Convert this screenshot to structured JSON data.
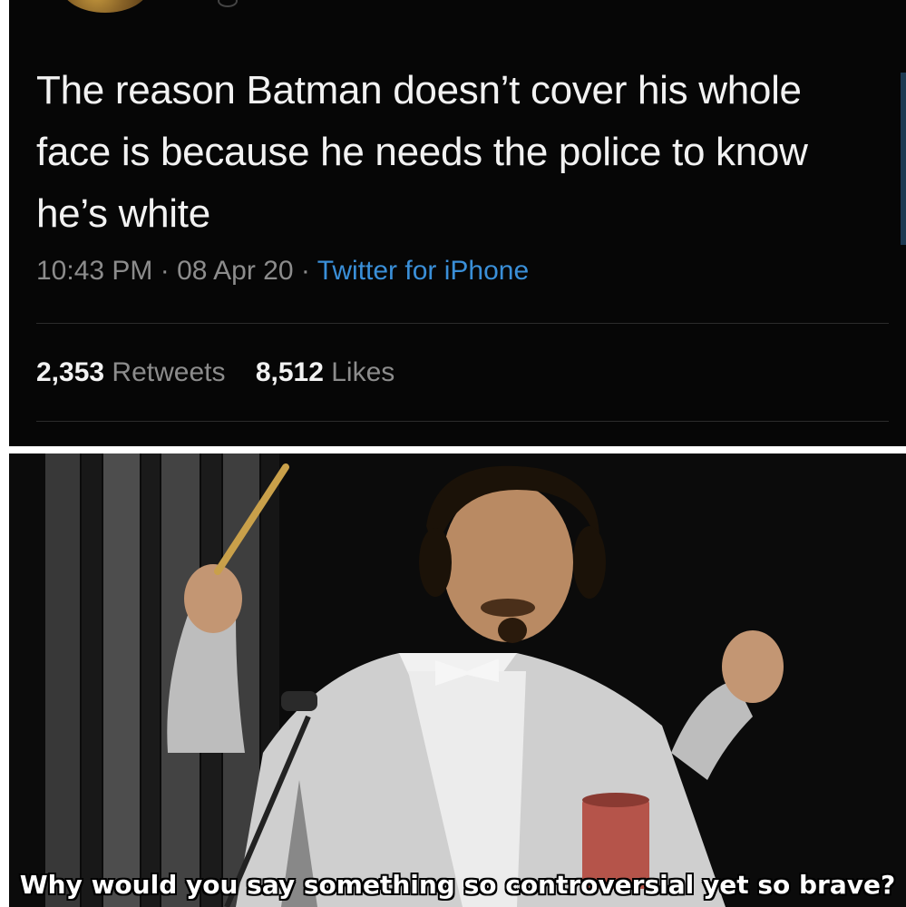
{
  "tweet": {
    "text": "The reason Batman doesn’t cover his whole face is because he needs the police to know he’s white",
    "time": "10:43 PM",
    "date": "08 Apr 20",
    "separator": "·",
    "source": "Twitter for iPhone",
    "retweets_count": "2,353",
    "retweets_label": "Retweets",
    "likes_count": "8,512",
    "likes_label": "Likes"
  },
  "photo": {
    "caption": "Why would you say something so controversial yet so brave?"
  },
  "colors": {
    "tweet_background": "#060606",
    "tweet_text": "#f2f2f2",
    "meta_text": "#8c8c8c",
    "source_link": "#3a8fd8"
  }
}
